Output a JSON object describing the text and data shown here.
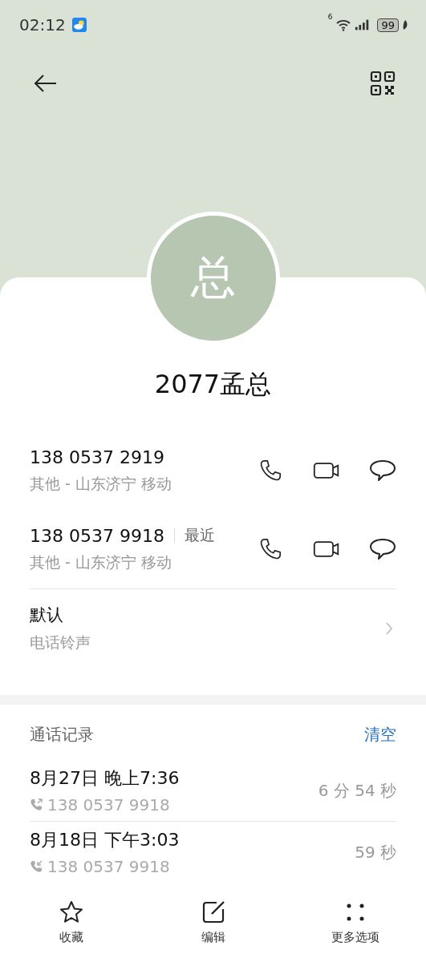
{
  "status_bar": {
    "time": "02:12",
    "wifi_label": "6",
    "battery": "99"
  },
  "contact": {
    "avatar": "总",
    "name": "2077孟总"
  },
  "numbers": [
    {
      "number": "138 0537 2919",
      "detail": "其他 - 山东济宁 移动"
    },
    {
      "number": "138 0537 9918",
      "tag": "最近",
      "detail": "其他 - 山东济宁 移动"
    }
  ],
  "ringtone": {
    "value": "默认",
    "label": "电话铃声"
  },
  "call_log": {
    "title": "通话记录",
    "clear": "清空",
    "entries": [
      {
        "date": "8月27日 晚上7:36",
        "number": "138 0537 9918",
        "duration": "6 分 54 秒",
        "kind": "outgoing"
      },
      {
        "date": "8月18日 下午3:03",
        "number": "138 0537 9918",
        "duration": "59 秒",
        "kind": "incoming"
      }
    ]
  },
  "bottom_bar": [
    {
      "label": "收藏",
      "kind": "star"
    },
    {
      "label": "编辑",
      "kind": "edit"
    },
    {
      "label": "更多选项",
      "kind": "more"
    }
  ]
}
